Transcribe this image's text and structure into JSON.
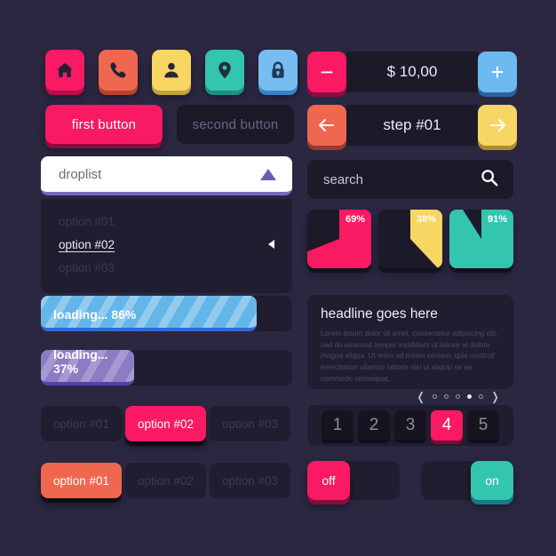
{
  "theme": {
    "background": "#2b2741",
    "panel_dark": "#1c1929",
    "panel_dark2": "#211d30",
    "pink": "#fa1a64",
    "coral": "#f0674f",
    "yellow": "#f8d663",
    "teal": "#34c5ae",
    "blue": "#6cb9ef",
    "purple": "#8d7cc4",
    "white": "#ffffff"
  },
  "icon_buttons": [
    {
      "name": "home-icon",
      "label": "home",
      "color": "#fa1a64",
      "shadow": "#b4104a"
    },
    {
      "name": "phone-icon",
      "label": "phone",
      "color": "#f0674f",
      "shadow": "#b8432f"
    },
    {
      "name": "user-icon",
      "label": "user",
      "color": "#f8d663",
      "shadow": "#c2a33d"
    },
    {
      "name": "pin-icon",
      "label": "location",
      "color": "#34c5ae",
      "shadow": "#1f8e7d"
    },
    {
      "name": "lock-icon",
      "label": "lock",
      "color": "#76bdf2",
      "shadow": "#3d7fc4"
    }
  ],
  "buttons": {
    "primary_label": "first button",
    "primary_color": "#fa1a64",
    "secondary_label": "second button"
  },
  "droplist": {
    "label": "droplist",
    "options": [
      {
        "label": "option #01",
        "selected": false
      },
      {
        "label": "option #02",
        "selected": true
      },
      {
        "label": "option #03",
        "selected": false
      }
    ]
  },
  "progress": [
    {
      "label": "loading... 86%",
      "percent": 86,
      "color": "blue"
    },
    {
      "label": "loading... 37%",
      "percent": 37,
      "color": "purple"
    }
  ],
  "segmented": [
    {
      "name": "segmented-pink",
      "active_color": "#fa1a64",
      "items": [
        {
          "label": "option #01",
          "active": false
        },
        {
          "label": "option #02",
          "active": true
        },
        {
          "label": "option #03",
          "active": false
        }
      ]
    },
    {
      "name": "segmented-coral",
      "active_color": "#f0674f",
      "items": [
        {
          "label": "option #01",
          "active": true
        },
        {
          "label": "option #02",
          "active": false
        },
        {
          "label": "option #03",
          "active": false
        }
      ]
    }
  ],
  "counter": {
    "value": "$ 10,00",
    "minus_label": "−",
    "plus_label": "+",
    "minus_color": "#fa1a64",
    "plus_color": "#6cb9ef"
  },
  "stepper": {
    "value": "step #01",
    "prev_label": "←",
    "next_label": "→",
    "prev_color": "#f0674f",
    "next_color": "#f8d663"
  },
  "search": {
    "placeholder": "search",
    "icon": "search-icon"
  },
  "chart_data": {
    "type": "pie",
    "title": "",
    "tiles": [
      {
        "label": "69%",
        "value": 69,
        "color": "#fa1a64"
      },
      {
        "label": "38%",
        "value": 38,
        "color": "#f8d663"
      },
      {
        "label": "91%",
        "value": 91,
        "color": "#34c5ae"
      }
    ],
    "xlabel": "",
    "ylabel": "",
    "legend": []
  },
  "card": {
    "headline": "headline goes here",
    "body": "Lorem ipsum dolor sit amet, consectetur adipiscing elit, sed do eiusmod tempor incididunt ut labore et dolore magna aliqua. Ut enim ad minim veniam, quis nostrud exercitation ullamco laboris nisi ut aliquip ex ea commodo consequat.",
    "prev_label": "❬",
    "next_label": "❭",
    "dots_total": 5,
    "dots_active_index": 3
  },
  "pagination": {
    "pages": [
      "1",
      "2",
      "3",
      "4",
      "5"
    ],
    "active_index": 3,
    "active_color": "#fa1a64"
  },
  "toggles": [
    {
      "name": "toggle-off",
      "label": "off",
      "state": "off",
      "color": "#fa1a64"
    },
    {
      "name": "toggle-on",
      "label": "on",
      "state": "on",
      "color": "#34c5ae"
    }
  ]
}
